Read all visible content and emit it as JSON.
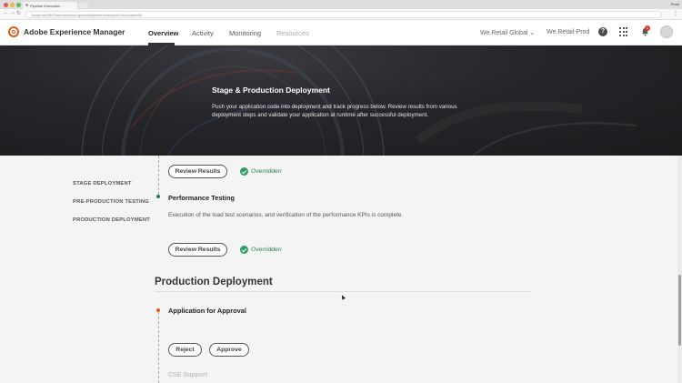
{
  "browser": {
    "tab_title": "Pipeline Execution",
    "user": "Pearl",
    "url": "localhost:4502/aem/ui/cloud-guides/pipeline/execution/1/execution/8"
  },
  "header": {
    "app_name": "Adobe Experience Manager",
    "nav": [
      "Overview",
      "Activity",
      "Monitoring",
      "Resources"
    ],
    "dropdown1": "We.Retail Global",
    "dropdown2": "We.Retail-Prod",
    "notification_count": "1"
  },
  "hero": {
    "title": "Stage & Production Deployment",
    "text": "Push your application code into deployment and track progress below. Review results from various deployment steps and validate your application at runtime after successful deployment."
  },
  "sidebar": {
    "items": [
      "STAGE DEPLOYMENT",
      "PRE-PRODUCTION TESTING",
      "PRODUCTION DEPLOYMENT"
    ]
  },
  "steps": {
    "review_label": "Review Results",
    "overridden": "Overridden",
    "performance_title": "Performance Testing",
    "performance_desc": "Execution of the load test scenarios, and verification of the performance KPIs is complete.",
    "production_title": "Production Deployment",
    "approval_title": "Application for Approval",
    "reject": "Reject",
    "approve": "Approve",
    "cse_support": "CSE Support"
  },
  "colors": {
    "accent": "#e35a1d",
    "success": "#2d9d68"
  }
}
